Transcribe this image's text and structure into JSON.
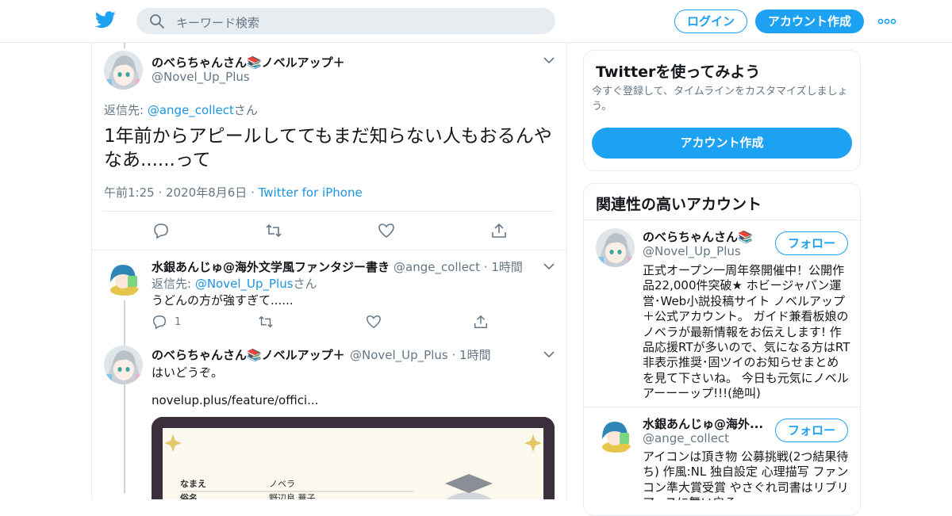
{
  "header": {
    "search_placeholder": "キーワード検索",
    "login_label": "ログイン",
    "signup_label": "アカウント作成"
  },
  "main_tweet": {
    "name": "のべらちゃんさん📚ノベルアップ＋",
    "handle": "@Novel_Up_Plus",
    "reply_prefix": "返信先: ",
    "reply_handle": "@ange_collect",
    "reply_suffix": "さん",
    "text": "1年前からアピールしててもまだ知らない人もおるんやなあ......って",
    "time": "午前1:25",
    "date": "2020年8月6日",
    "source": "Twitter for iPhone"
  },
  "reply1": {
    "name": "水銀あんじゅ@海外文学風ファンタジー書き",
    "handle": "@ange_collect",
    "time": "1時間",
    "reply_prefix": "返信先: ",
    "reply_handle": "@Novel_Up_Plus",
    "reply_suffix": "さん",
    "text": "うどんの方が強すぎて......",
    "reply_count": "1"
  },
  "reply2": {
    "name": "のべらちゃんさん📚ノベルアップ＋",
    "handle": "@Novel_Up_Plus",
    "time": "1時間",
    "text": "はいどうぞ。",
    "link": "novelup.plus/feature/offici...",
    "media_labels": [
      "なまえ",
      "ノベラ",
      "俗名",
      "野辺良 華子"
    ]
  },
  "sidebar": {
    "try_title": "Twitterを使ってみよう",
    "try_sub": "今すぐ登録して、タイムラインをカスタマイズしましょう。",
    "try_button": "アカウント作成",
    "related_title": "関連性の高いアカウント",
    "accounts": [
      {
        "name": "のべらちゃんさん📚",
        "handle": "@Novel_Up_Plus",
        "follow": "フォロー",
        "bio": "正式オープン一周年祭開催中！公開作品22,000件突破★ ホビージャパン運営･Web小説投稿サイト ノベルアップ＋公式アカウント。 ガイド兼看板娘のノベラが最新情報をお伝えします! 作品応援RTが多いので、気になる方はRT非表示推奨･固ツイのお知らせまとめを見て下さいね。 今日も元気にノベルアーーーップ!!!(絶叫)"
      },
      {
        "name": "水銀あんじゅ@海外...",
        "handle": "@ange_collect",
        "follow": "フォロー",
        "bio": "アイコンは頂き物 公募挑戦(2つ結果待ち) 作風:NL 独自設定 心理描写 ファンコン準大賞受賞 やさぐれ司書はリブリアースに舞い戻る"
      }
    ]
  },
  "colors": {
    "accent": "#1da1f2",
    "link": "#1b95e0",
    "muted": "#657786",
    "border": "#e6ecf0"
  }
}
